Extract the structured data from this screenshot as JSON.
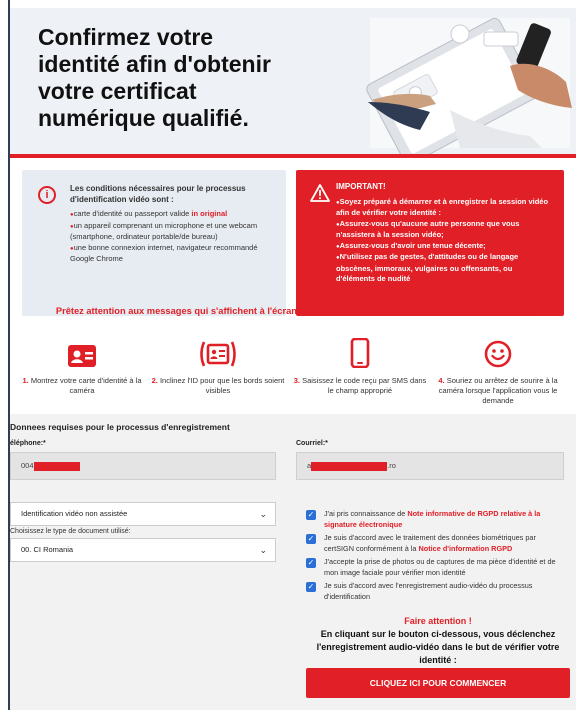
{
  "hero": {
    "title": "Confirmez votre identité afin d'obtenir votre certificat numérique qualifié."
  },
  "conditions": {
    "icon": "info-icon",
    "title": "Les conditions nécessaires pour le processus d'identification vidéo sont :",
    "item1_text": "carte d'identité ou passeport valide ",
    "item1_highlight": "in original",
    "item2": "un appareil comprenant un microphone et une webcam (smartphone, ordinateur portable/de bureau)",
    "item3": "une bonne connexion internet, navigateur recommandé Google Chrome"
  },
  "important": {
    "icon": "warning-icon",
    "title": "IMPORTANT!",
    "items": [
      "Soyez préparé à démarrer et à enregistrer la session vidéo afin de vérifier votre identité :",
      "Assurez-vous qu'aucune autre personne que vous n'assistera à la session vidéo;",
      "Assurez-vous d'avoir une tenue décente;",
      "N'utilisez pas de gestes, d'attitudes ou de langage obscènes, immoraux, vulgaires ou offensants, ou d'éléments de nudité"
    ]
  },
  "attention": "Prêtez attention aux messages qui s'affichent à l'écran et suivez-les comme l'application vous le demande :",
  "steps": [
    {
      "num": "1.",
      "text": "Montrez votre carte d'identité à la caméra",
      "icon": "id-card-icon"
    },
    {
      "num": "2.",
      "text": "Inclinez l'ID pour que les bords soient visibles",
      "icon": "tilted-id-icon"
    },
    {
      "num": "3.",
      "text": "Saisissez le code reçu par SMS dans le champ approprié",
      "icon": "smartphone-icon"
    },
    {
      "num": "4.",
      "text": "Souriez ou arrêtez de sourire à la caméra lorsque l'application vous le demande",
      "icon": "smile-icon"
    }
  ],
  "form": {
    "title": "Donnees requises pour le processus d'enregistrement",
    "phone_label": "éléphone:*",
    "phone_value": "004",
    "email_label": "Courriel:*",
    "email_prefix": "a",
    "email_suffix": ".ro",
    "method_value": "Identification vidéo non assistée",
    "doc_label": "Choisissez le type de document utilisé:",
    "doc_value": "00. CI Romania"
  },
  "consents": [
    {
      "pre": "J'ai pris connaissance de ",
      "link": "Note informative de RGPD relative à la signature électronique",
      "post": ""
    },
    {
      "pre": "Je suis d'accord avec le traitement des données biométriques par certSIGN conformément à la ",
      "link": "Notice d'information RGPD",
      "post": ""
    },
    {
      "pre": "J'accepte la prise de photos ou de captures de ma pièce d'identité et de mon image faciale pour vérifier mon identité",
      "link": "",
      "post": ""
    },
    {
      "pre": "Je suis d'accord avec l'enregistrement audio-vidéo du processus d'identification",
      "link": "",
      "post": ""
    }
  ],
  "notice": {
    "title": "Faire attention !",
    "text": "En cliquant sur le bouton ci-dessous, vous déclenchez l'enregistrement audio-vidéo dans le but de vérifier votre identité :"
  },
  "cta_label": "CLIQUEZ ICI POUR COMMENCER",
  "colors": {
    "accent": "#e11f26",
    "checkbox": "#2a6ed8",
    "panel": "#e7ecf2"
  }
}
